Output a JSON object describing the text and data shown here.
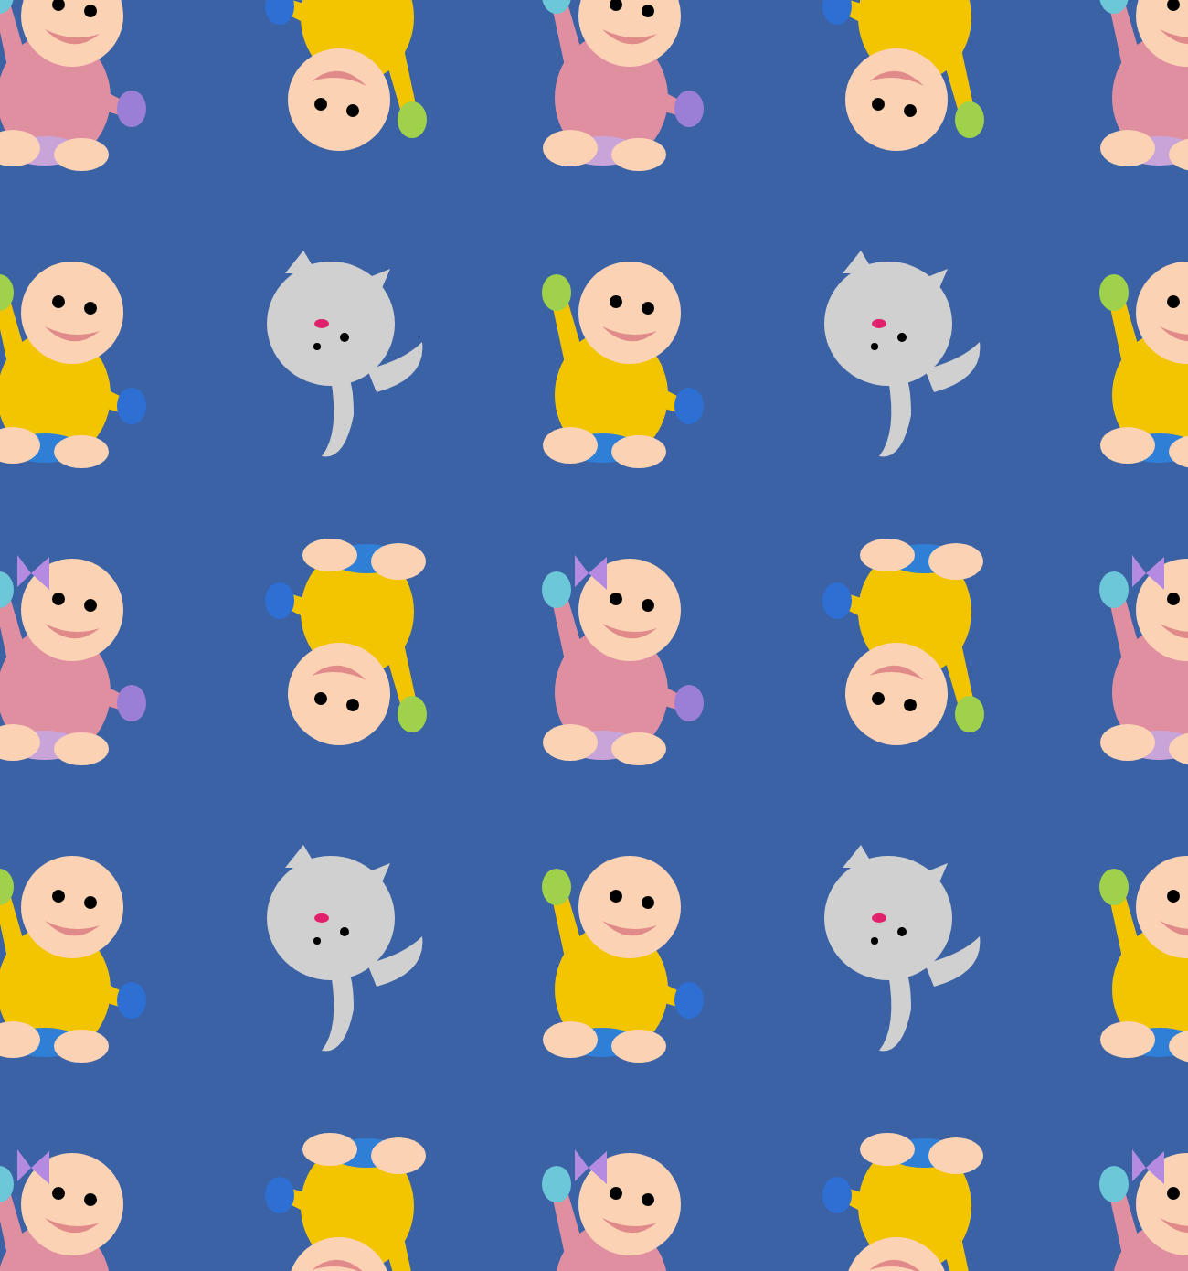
{
  "pattern": {
    "rows": [
      {
        "figures": [
          {
            "kind": "girl",
            "flipped": false
          },
          {
            "kind": "boy",
            "flipped": true
          },
          {
            "kind": "girl",
            "flipped": false
          },
          {
            "kind": "boy",
            "flipped": true
          },
          {
            "kind": "girl",
            "flipped": false
          }
        ]
      },
      {
        "figures": [
          {
            "kind": "boy",
            "flipped": false
          },
          {
            "kind": "bunny",
            "flipped": false
          },
          {
            "kind": "boy",
            "flipped": false
          },
          {
            "kind": "bunny",
            "flipped": false
          },
          {
            "kind": "boy",
            "flipped": false
          }
        ]
      },
      {
        "figures": [
          {
            "kind": "girl",
            "flipped": false
          },
          {
            "kind": "boy",
            "flipped": true
          },
          {
            "kind": "girl",
            "flipped": false
          },
          {
            "kind": "boy",
            "flipped": true
          },
          {
            "kind": "girl",
            "flipped": false
          }
        ]
      },
      {
        "figures": [
          {
            "kind": "boy",
            "flipped": false
          },
          {
            "kind": "bunny",
            "flipped": false
          },
          {
            "kind": "boy",
            "flipped": false
          },
          {
            "kind": "bunny",
            "flipped": false
          },
          {
            "kind": "boy",
            "flipped": false
          }
        ]
      },
      {
        "figures": [
          {
            "kind": "girl",
            "flipped": false
          },
          {
            "kind": "boy",
            "flipped": true
          },
          {
            "kind": "girl",
            "flipped": false
          },
          {
            "kind": "boy",
            "flipped": true
          },
          {
            "kind": "girl",
            "flipped": false
          }
        ]
      }
    ]
  }
}
